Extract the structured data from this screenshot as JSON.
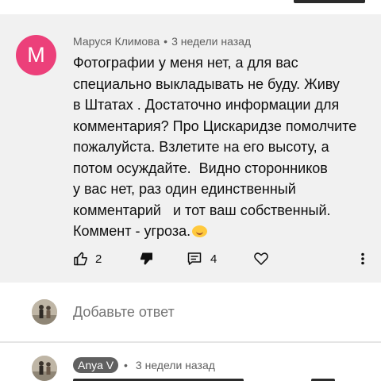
{
  "comment": {
    "author": "Маруся Климова",
    "avatar_letter": "M",
    "avatar_color": "#ec407a",
    "time": "3 недели назад",
    "separator": "•",
    "lines": [
      "Фотографии у меня нет, а для вас",
      "специально выкладывать не буду. Живу",
      "в Штатах . Достаточно информации для",
      "комментария? Про Цискаридзе помолчите",
      "пожалуйста. Взлетите на его высоту, а",
      "потом осуждайте.  Видно сторонников",
      "у вас нет, раз один единственный",
      "комментарий   и тот ваш собственный.",
      "Коммент - угроза."
    ],
    "like_count": "2",
    "reply_count": "4",
    "icons": [
      "thumb-up-icon",
      "thumb-down-icon",
      "reply-icon",
      "heart-icon",
      "more-vert-icon",
      "smiling-emoji-icon"
    ]
  },
  "composer": {
    "placeholder": "Добавьте ответ"
  },
  "reply": {
    "author": "Anya V",
    "time": "3 недели назад",
    "separator": "•"
  },
  "colors": {
    "comment_background": "#f1f1f1",
    "meta_text": "#606060",
    "author_badge": "#606060"
  }
}
